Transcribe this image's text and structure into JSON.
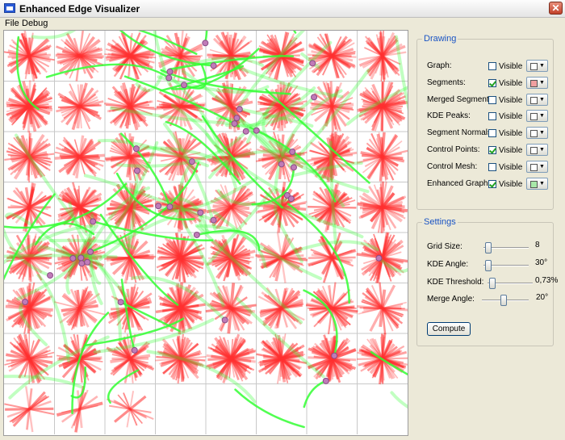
{
  "window": {
    "title": "Enhanced Edge Visualizer",
    "close_glyph": "✕"
  },
  "menu": {
    "items": [
      "File",
      "Debug"
    ]
  },
  "drawing": {
    "title": "Drawing",
    "rows": [
      {
        "label": "Graph:",
        "visible_label": "Visible",
        "checked": false,
        "color": "#ffffff"
      },
      {
        "label": "Segments:",
        "visible_label": "Visible",
        "checked": true,
        "color": "#f0a0a0"
      },
      {
        "label": "Merged Segments:",
        "visible_label": "Visible",
        "checked": false,
        "color": "#ffffff"
      },
      {
        "label": "KDE Peaks:",
        "visible_label": "Visible",
        "checked": false,
        "color": "#ffffff"
      },
      {
        "label": "Segment Normals:",
        "visible_label": "Visible",
        "checked": false,
        "color": "#ffffff"
      },
      {
        "label": "Control Points:",
        "visible_label": "Visible",
        "checked": true,
        "color": "#ffffff"
      },
      {
        "label": "Control Mesh:",
        "visible_label": "Visible",
        "checked": false,
        "color": "#ffffff"
      },
      {
        "label": "Enhanced Graph:",
        "visible_label": "Visible",
        "checked": true,
        "color": "#a8e8a8"
      }
    ]
  },
  "settings": {
    "title": "Settings",
    "sliders": [
      {
        "label": "Grid Size:",
        "value": "8",
        "level": 0.05
      },
      {
        "label": "KDE Angle:",
        "value": "30°",
        "level": 0.05
      },
      {
        "label": "KDE Threshold:",
        "value": "0,73%",
        "level": 0.05
      },
      {
        "label": "Merge Angle:",
        "value": "20°",
        "level": 0.45
      }
    ],
    "compute_label": "Compute"
  },
  "visualization": {
    "grid_size": 8,
    "segment_color": "#ff3030",
    "edge_color": "#33ff33",
    "control_point_color": "#c07bb8"
  }
}
